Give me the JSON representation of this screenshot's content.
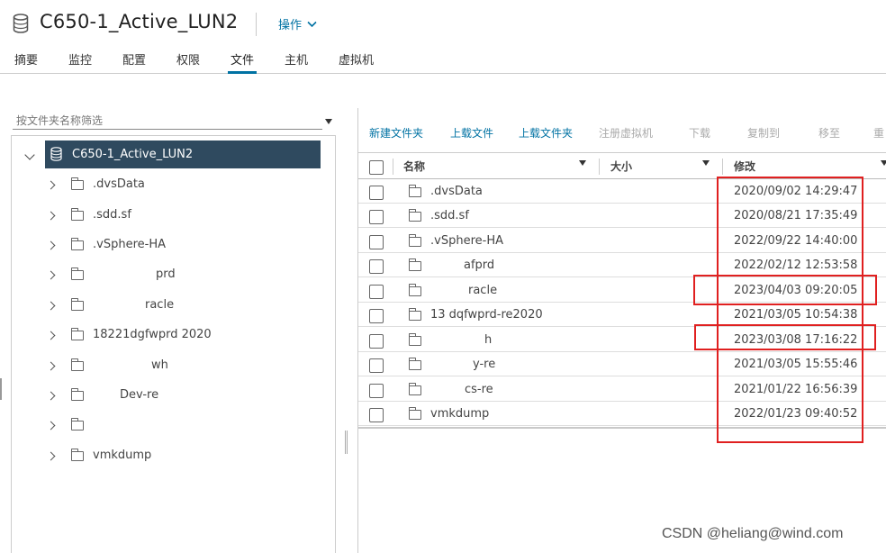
{
  "header": {
    "title": "C650-1_Active_LUN2",
    "actions_label": "操作",
    "tabs": [
      {
        "label": "摘要"
      },
      {
        "label": "监控"
      },
      {
        "label": "配置"
      },
      {
        "label": "权限"
      },
      {
        "label": "文件",
        "active": true
      },
      {
        "label": "主机"
      },
      {
        "label": "虚拟机"
      }
    ]
  },
  "left": {
    "filter_placeholder": "按文件夹名称筛选",
    "root": {
      "label": "C650-1_Active_LUN2",
      "expanded": true
    },
    "nodes": [
      {
        "label": ".dvsData"
      },
      {
        "label": ".sdd.sf"
      },
      {
        "label": ".vSphere-HA"
      },
      {
        "label": "prd"
      },
      {
        "label": "racle"
      },
      {
        "label": "18221dgfwprd 2020"
      },
      {
        "label": "wh"
      },
      {
        "label": "Dev-re"
      },
      {
        "label": ""
      },
      {
        "label": "vmkdump"
      }
    ]
  },
  "toolbar": {
    "items": [
      {
        "label": "新建文件夹",
        "enabled": true
      },
      {
        "label": "上载文件",
        "enabled": true
      },
      {
        "label": "上载文件夹",
        "enabled": true
      },
      {
        "label": "注册虚拟机",
        "enabled": false
      },
      {
        "label": "下载",
        "enabled": false
      },
      {
        "label": "复制到",
        "enabled": false
      },
      {
        "label": "移至",
        "enabled": false
      },
      {
        "label": "重",
        "enabled": false
      }
    ]
  },
  "grid": {
    "columns": [
      "名称",
      "大小",
      "修改"
    ],
    "rows": [
      {
        "name": ".dvsData",
        "modified": "2020/09/02 14:29:47"
      },
      {
        "name": ".sdd.sf",
        "modified": "2020/08/21 17:35:49"
      },
      {
        "name": ".vSphere-HA",
        "modified": "2022/09/22 14:40:00"
      },
      {
        "name": "afprd",
        "modified": "2022/02/12 12:53:58"
      },
      {
        "name": "racle",
        "modified": "2023/04/03 09:20:05"
      },
      {
        "name": "13 dqfwprd-re2020",
        "modified": "2021/03/05 10:54:38"
      },
      {
        "name": "h",
        "modified": "2023/03/08 17:16:22"
      },
      {
        "name": "y-re",
        "modified": "2021/03/05 15:55:46"
      },
      {
        "name": "cs-re",
        "modified": "2021/01/22 16:56:39"
      },
      {
        "name": "vmkdump",
        "modified": "2022/01/23 09:40:52"
      }
    ]
  },
  "watermark": "CSDN @heliang@wind.com",
  "colors": {
    "accent": "#0072a3",
    "selected_bg": "#2f4a5f",
    "highlight": "#e02020"
  }
}
